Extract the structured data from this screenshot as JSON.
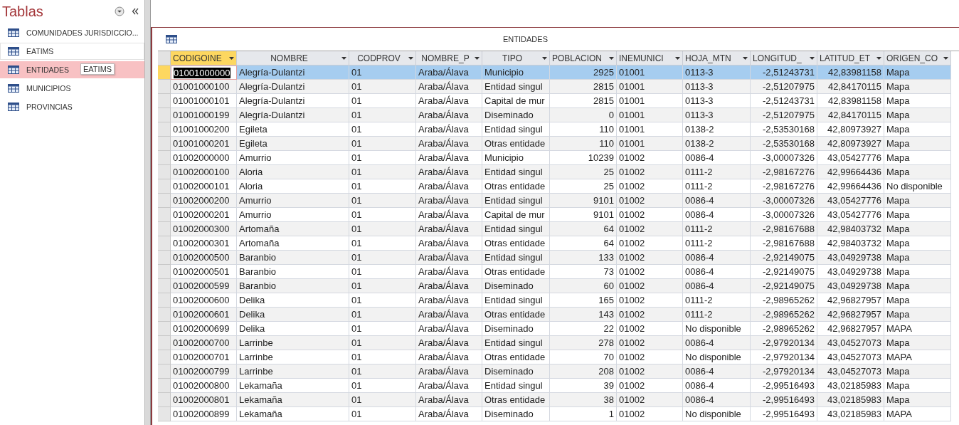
{
  "sidebar": {
    "title": "Tablas",
    "items": [
      {
        "label": "COMUNIDADES JURISDICCIO...",
        "selected": false,
        "hovered": false
      },
      {
        "label": "EATIMS",
        "selected": false,
        "hovered": true
      },
      {
        "label": "ENTIDADES",
        "selected": true,
        "hovered": false
      },
      {
        "label": "MUNICIPIOS",
        "selected": false,
        "hovered": false
      },
      {
        "label": "PROVINCIAS",
        "selected": false,
        "hovered": false
      }
    ],
    "tooltip": "EATIMS"
  },
  "table": {
    "title": "ENTIDADES",
    "columns": [
      {
        "label": "CODIGOINE",
        "kind": "text",
        "selected": true
      },
      {
        "label": "NOMBRE",
        "kind": "text",
        "selected": false
      },
      {
        "label": "CODPROV",
        "kind": "text",
        "selected": false
      },
      {
        "label": "NOMBRE_P",
        "kind": "text",
        "selected": false
      },
      {
        "label": "TIPO",
        "kind": "text",
        "selected": false
      },
      {
        "label": "POBLACION",
        "kind": "number",
        "selected": false
      },
      {
        "label": "INEMUNICI",
        "kind": "text",
        "selected": false
      },
      {
        "label": "HOJA_MTN",
        "kind": "text",
        "selected": false
      },
      {
        "label": "LONGITUD_",
        "kind": "number",
        "selected": false
      },
      {
        "label": "LATITUD_ET",
        "kind": "number",
        "selected": false
      },
      {
        "label": "ORIGEN_CO",
        "kind": "text",
        "selected": false
      }
    ],
    "rows": [
      {
        "selected": true,
        "cells": [
          "01001000000",
          "Alegría-Dulantzi",
          "01",
          "Araba/Álava",
          "Municipio",
          "2925",
          "01001",
          "0113-3",
          "-2,51243731",
          "42,83981158",
          "Mapa"
        ]
      },
      {
        "selected": false,
        "cells": [
          "01001000100",
          "Alegría-Dulantzi",
          "01",
          "Araba/Álava",
          "Entidad singul",
          "2815",
          "01001",
          "0113-3",
          "-2,51207975",
          "42,84170115",
          "Mapa"
        ]
      },
      {
        "selected": false,
        "cells": [
          "01001000101",
          "Alegría-Dulantzi",
          "01",
          "Araba/Álava",
          "Capital de mur",
          "2815",
          "01001",
          "0113-3",
          "-2,51243731",
          "42,83981158",
          "Mapa"
        ]
      },
      {
        "selected": false,
        "cells": [
          "01001000199",
          "Alegría-Dulantzi",
          "01",
          "Araba/Álava",
          "Diseminado",
          "0",
          "01001",
          "0113-3",
          "-2,51207975",
          "42,84170115",
          "Mapa"
        ]
      },
      {
        "selected": false,
        "cells": [
          "01001000200",
          "Egileta",
          "01",
          "Araba/Álava",
          "Entidad singul",
          "110",
          "01001",
          "0138-2",
          "-2,53530168",
          "42,80973927",
          "Mapa"
        ]
      },
      {
        "selected": false,
        "cells": [
          "01001000201",
          "Egileta",
          "01",
          "Araba/Álava",
          "Otras entidade",
          "110",
          "01001",
          "0138-2",
          "-2,53530168",
          "42,80973927",
          "Mapa"
        ]
      },
      {
        "selected": false,
        "cells": [
          "01002000000",
          "Amurrio",
          "01",
          "Araba/Álava",
          "Municipio",
          "10239",
          "01002",
          "0086-4",
          "-3,00007326",
          "43,05427776",
          "Mapa"
        ]
      },
      {
        "selected": false,
        "cells": [
          "01002000100",
          "Aloria",
          "01",
          "Araba/Álava",
          "Entidad singul",
          "25",
          "01002",
          "0111-2",
          "-2,98167276",
          "42,99664436",
          "Mapa"
        ]
      },
      {
        "selected": false,
        "cells": [
          "01002000101",
          "Aloria",
          "01",
          "Araba/Álava",
          "Otras entidade",
          "25",
          "01002",
          "0111-2",
          "-2,98167276",
          "42,99664436",
          "No disponible"
        ]
      },
      {
        "selected": false,
        "cells": [
          "01002000200",
          "Amurrio",
          "01",
          "Araba/Álava",
          "Entidad singul",
          "9101",
          "01002",
          "0086-4",
          "-3,00007326",
          "43,05427776",
          "Mapa"
        ]
      },
      {
        "selected": false,
        "cells": [
          "01002000201",
          "Amurrio",
          "01",
          "Araba/Álava",
          "Capital de mur",
          "9101",
          "01002",
          "0086-4",
          "-3,00007326",
          "43,05427776",
          "Mapa"
        ]
      },
      {
        "selected": false,
        "cells": [
          "01002000300",
          "Artomaña",
          "01",
          "Araba/Álava",
          "Entidad singul",
          "64",
          "01002",
          "0111-2",
          "-2,98167688",
          "42,98403732",
          "Mapa"
        ]
      },
      {
        "selected": false,
        "cells": [
          "01002000301",
          "Artomaña",
          "01",
          "Araba/Álava",
          "Otras entidade",
          "64",
          "01002",
          "0111-2",
          "-2,98167688",
          "42,98403732",
          "Mapa"
        ]
      },
      {
        "selected": false,
        "cells": [
          "01002000500",
          "Baranbio",
          "01",
          "Araba/Álava",
          "Entidad singul",
          "133",
          "01002",
          "0086-4",
          "-2,92149075",
          "43,04929738",
          "Mapa"
        ]
      },
      {
        "selected": false,
        "cells": [
          "01002000501",
          "Baranbio",
          "01",
          "Araba/Álava",
          "Otras entidade",
          "73",
          "01002",
          "0086-4",
          "-2,92149075",
          "43,04929738",
          "Mapa"
        ]
      },
      {
        "selected": false,
        "cells": [
          "01002000599",
          "Baranbio",
          "01",
          "Araba/Álava",
          "Diseminado",
          "60",
          "01002",
          "0086-4",
          "-2,92149075",
          "43,04929738",
          "Mapa"
        ]
      },
      {
        "selected": false,
        "cells": [
          "01002000600",
          "Delika",
          "01",
          "Araba/Álava",
          "Entidad singul",
          "165",
          "01002",
          "0111-2",
          "-2,98965262",
          "42,96827957",
          "Mapa"
        ]
      },
      {
        "selected": false,
        "cells": [
          "01002000601",
          "Delika",
          "01",
          "Araba/Álava",
          "Otras entidade",
          "143",
          "01002",
          "0111-2",
          "-2,98965262",
          "42,96827957",
          "Mapa"
        ]
      },
      {
        "selected": false,
        "cells": [
          "01002000699",
          "Delika",
          "01",
          "Araba/Álava",
          "Diseminado",
          "22",
          "01002",
          "No disponible",
          "-2,98965262",
          "42,96827957",
          "MAPA"
        ]
      },
      {
        "selected": false,
        "cells": [
          "01002000700",
          "Larrinbe",
          "01",
          "Araba/Álava",
          "Entidad singul",
          "278",
          "01002",
          "0086-4",
          "-2,97920134",
          "43,04527073",
          "Mapa"
        ]
      },
      {
        "selected": false,
        "cells": [
          "01002000701",
          "Larrinbe",
          "01",
          "Araba/Álava",
          "Otras entidade",
          "70",
          "01002",
          "No disponible",
          "-2,97920134",
          "43,04527073",
          "MAPA"
        ]
      },
      {
        "selected": false,
        "cells": [
          "01002000799",
          "Larrinbe",
          "01",
          "Araba/Álava",
          "Diseminado",
          "208",
          "01002",
          "0086-4",
          "-2,97920134",
          "43,04527073",
          "Mapa"
        ]
      },
      {
        "selected": false,
        "cells": [
          "01002000800",
          "Lekamaña",
          "01",
          "Araba/Álava",
          "Entidad singul",
          "39",
          "01002",
          "0086-4",
          "-2,99516493",
          "43,02185983",
          "Mapa"
        ]
      },
      {
        "selected": false,
        "cells": [
          "01002000801",
          "Lekamaña",
          "01",
          "Araba/Álava",
          "Otras entidade",
          "38",
          "01002",
          "0086-4",
          "-2,99516493",
          "43,02185983",
          "Mapa"
        ]
      },
      {
        "selected": false,
        "cells": [
          "01002000899",
          "Lekamaña",
          "01",
          "Araba/Álava",
          "Diseminado",
          "1",
          "01002",
          "No disponible",
          "-2,99516493",
          "43,02185983",
          "MAPA"
        ]
      }
    ]
  }
}
